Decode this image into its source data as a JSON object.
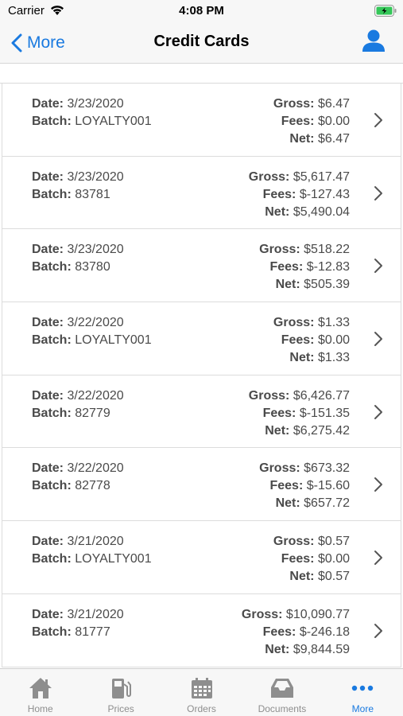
{
  "status_bar": {
    "carrier": "Carrier",
    "time": "4:08 PM"
  },
  "nav": {
    "back_label": "More",
    "title": "Credit Cards"
  },
  "labels": {
    "date": "Date:",
    "batch": "Batch:",
    "gross": "Gross:",
    "fees": "Fees:",
    "net": "Net:"
  },
  "rows": [
    {
      "date": "3/23/2020",
      "batch": "LOYALTY001",
      "gross": "$6.47",
      "fees": "$0.00",
      "net": "$6.47"
    },
    {
      "date": "3/23/2020",
      "batch": "83781",
      "gross": "$5,617.47",
      "fees": "$-127.43",
      "net": "$5,490.04"
    },
    {
      "date": "3/23/2020",
      "batch": "83780",
      "gross": "$518.22",
      "fees": "$-12.83",
      "net": "$505.39"
    },
    {
      "date": "3/22/2020",
      "batch": "LOYALTY001",
      "gross": "$1.33",
      "fees": "$0.00",
      "net": "$1.33"
    },
    {
      "date": "3/22/2020",
      "batch": "82779",
      "gross": "$6,426.77",
      "fees": "$-151.35",
      "net": "$6,275.42"
    },
    {
      "date": "3/22/2020",
      "batch": "82778",
      "gross": "$673.32",
      "fees": "$-15.60",
      "net": "$657.72"
    },
    {
      "date": "3/21/2020",
      "batch": "LOYALTY001",
      "gross": "$0.57",
      "fees": "$0.00",
      "net": "$0.57"
    },
    {
      "date": "3/21/2020",
      "batch": "81777",
      "gross": "$10,090.77",
      "fees": "$-246.18",
      "net": "$9,844.59"
    }
  ],
  "tabs": [
    {
      "label": "Home",
      "icon": "home-icon"
    },
    {
      "label": "Prices",
      "icon": "gas-pump-icon"
    },
    {
      "label": "Orders",
      "icon": "calendar-icon"
    },
    {
      "label": "Documents",
      "icon": "inbox-icon"
    },
    {
      "label": "More",
      "icon": "more-dots-icon",
      "active": true
    }
  ],
  "colors": {
    "accent": "#1a7ae0",
    "inactive_tab": "#8e8e8e",
    "battery": "#35c759"
  }
}
